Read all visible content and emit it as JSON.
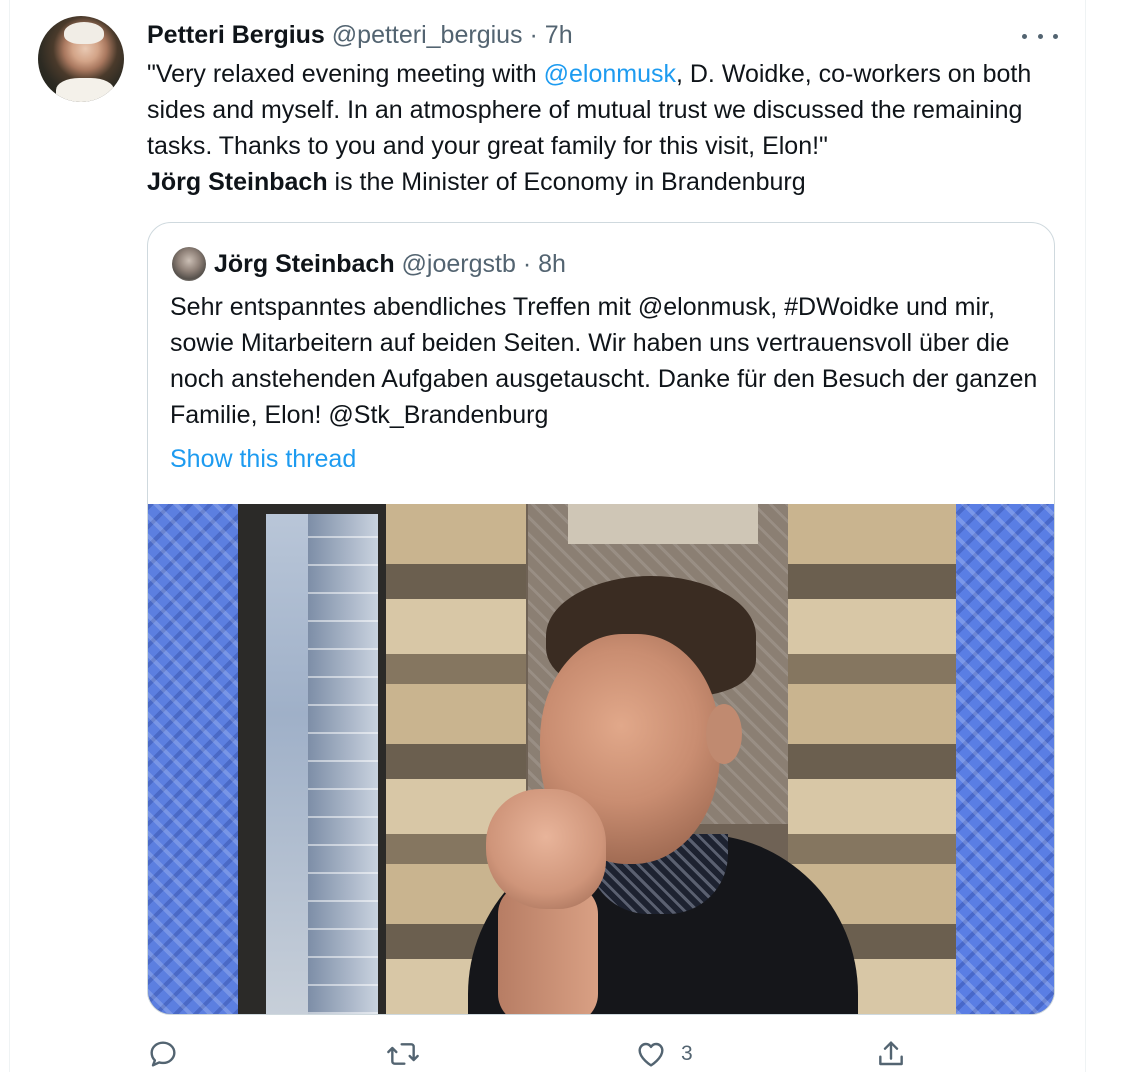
{
  "tweet": {
    "author_name": "Petteri Bergius",
    "author_handle": "@petteri_bergius",
    "separator": "·",
    "time": "7h",
    "text_part1": "\"Very relaxed evening meeting with ",
    "mention": "@elonmusk",
    "text_part2": ", D. Woidke, co-workers on both sides and myself. In an atmosphere of mutual trust we discussed the remaining tasks. Thanks to you and your great family for this visit, Elon!\"",
    "bold_name": "Jörg Steinbach",
    "text_part3": " is the Minister of Economy in Brandenburg"
  },
  "quoted_tweet": {
    "author_name": "Jörg Steinbach",
    "author_handle": "@joergstb",
    "separator": "·",
    "time": "8h",
    "text": "Sehr entspanntes abendliches Treffen mit @elonmusk, #DWoidke und mir, sowie Mitarbeitern auf beiden Seiten. Wir haben uns vertrauensvoll über die noch anstehenden Aufgaben ausgetauscht. Danke für den Besuch der ganzen Familie, Elon! @Stk_Brandenburg",
    "show_thread_label": "Show this thread"
  },
  "actions": {
    "reply_icon": "reply-icon",
    "retweet_icon": "retweet-icon",
    "like_icon": "like-icon",
    "like_count": "3",
    "share_icon": "share-icon"
  },
  "colors": {
    "accent": "#1d9bf0",
    "secondary_text": "#536471",
    "primary_text": "#0f1419",
    "border": "#cfd9de"
  }
}
